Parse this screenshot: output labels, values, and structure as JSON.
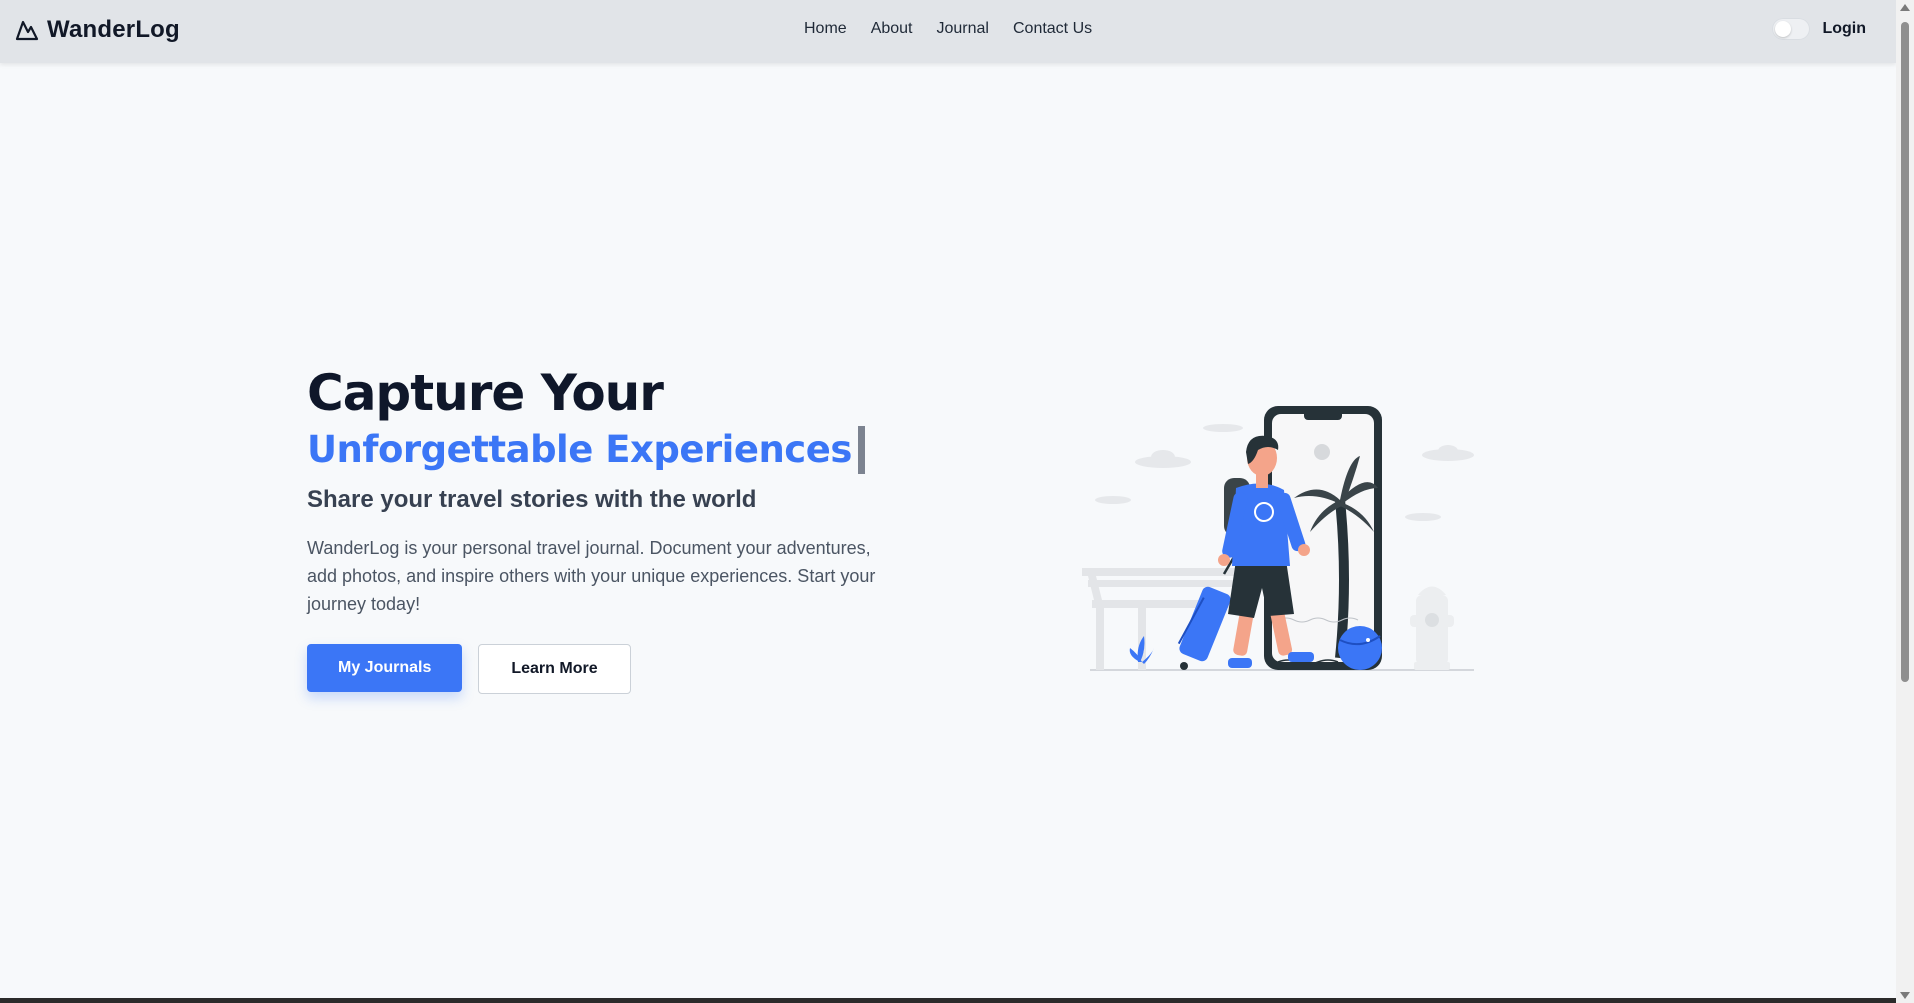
{
  "brand": {
    "name": "WanderLog",
    "icon": "mountain-icon"
  },
  "nav": {
    "links": [
      "Home",
      "About",
      "Journal",
      "Contact Us"
    ],
    "login_label": "Login",
    "theme_toggle": "off"
  },
  "hero": {
    "title": "Capture Your",
    "highlight": "Unforgettable Experiences",
    "subtitle": "Share your travel stories with the world",
    "description": "WanderLog is your personal travel journal. Document your adventures, add photos, and inspire others with your unique experiences. Start your journey today!",
    "primary_button": "My Journals",
    "secondary_button": "Learn More"
  },
  "colors": {
    "accent": "#3b76f6",
    "navbar_bg": "#e1e4e8",
    "page_bg": "#f7f9fb",
    "illustration_dark": "#263238"
  }
}
